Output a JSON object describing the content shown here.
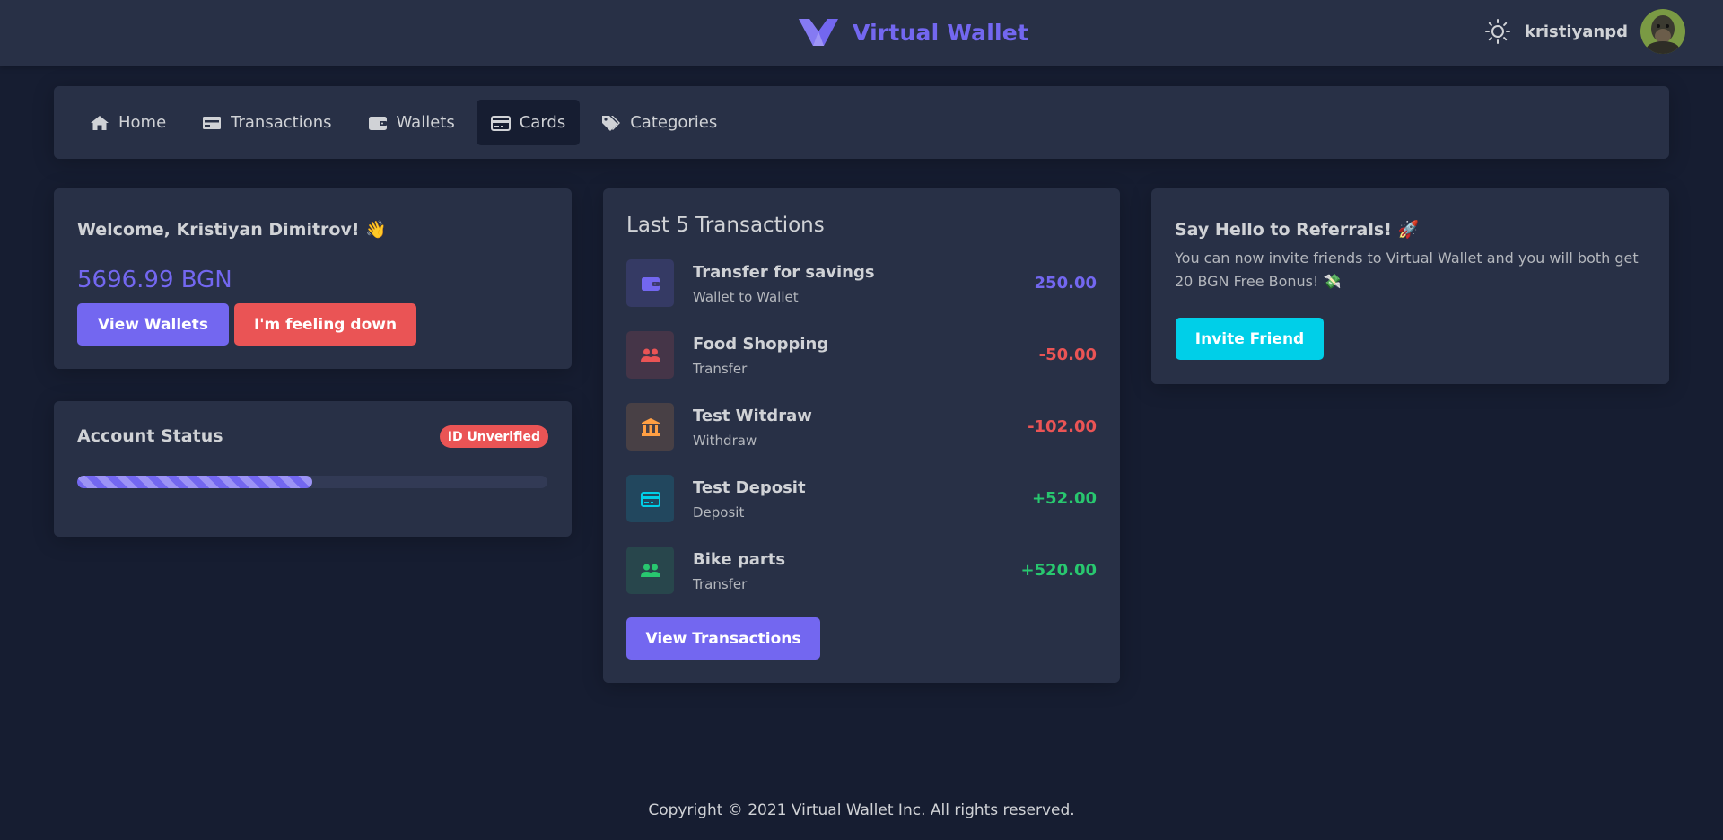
{
  "header": {
    "brand_name": "Virtual Wallet",
    "username": "kristiyanpd",
    "theme_icon": "sun-icon",
    "brand_color": "#7367f0"
  },
  "nav": {
    "items": [
      {
        "label": "Home",
        "icon": "home-icon",
        "active": false
      },
      {
        "label": "Transactions",
        "icon": "money-bill-icon",
        "active": false
      },
      {
        "label": "Wallets",
        "icon": "wallet-icon",
        "active": false
      },
      {
        "label": "Cards",
        "icon": "credit-card-icon",
        "active": true
      },
      {
        "label": "Categories",
        "icon": "tags-icon",
        "active": false
      }
    ]
  },
  "welcome": {
    "greeting": "Welcome, Kristiyan Dimitrov! 👋",
    "balance": "5696.99 BGN",
    "view_wallets_label": "View Wallets",
    "feeling_down_label": "I'm feeling down"
  },
  "account_status": {
    "title": "Account Status",
    "badge": "ID Unverified",
    "progress_fraction": 0.5
  },
  "transactions": {
    "title": "Last 5 Transactions",
    "items": [
      {
        "name": "Transfer for savings",
        "type": "Wallet to Wallet",
        "amount": "250.00",
        "icon": "wallet-icon",
        "color": "#7367f0"
      },
      {
        "name": "Food Shopping",
        "type": "Transfer",
        "amount": "-50.00",
        "icon": "users-icon",
        "color": "#ea5455"
      },
      {
        "name": "Test Witdraw",
        "type": "Withdraw",
        "amount": "-102.00",
        "icon": "bank-icon",
        "color": "#ff9f43"
      },
      {
        "name": "Test Deposit",
        "type": "Deposit",
        "amount": "+52.00",
        "icon": "credit-card-icon",
        "color": "#00cfe8"
      },
      {
        "name": "Bike parts",
        "type": "Transfer",
        "amount": "+520.00",
        "icon": "users-icon",
        "color": "#28c76f"
      }
    ],
    "amount_colors": [
      "#7367f0",
      "#ea5455",
      "#ea5455",
      "#28c76f",
      "#28c76f"
    ],
    "view_label": "View Transactions"
  },
  "referrals": {
    "title": "Say Hello to Referrals! 🚀",
    "text": "You can now invite friends to Virtual Wallet and you will both get 20 BGN Free Bonus! 💸",
    "invite_label": "Invite Friend"
  },
  "footer": {
    "text": "Copyright © 2021 Virtual Wallet Inc. All rights reserved."
  }
}
